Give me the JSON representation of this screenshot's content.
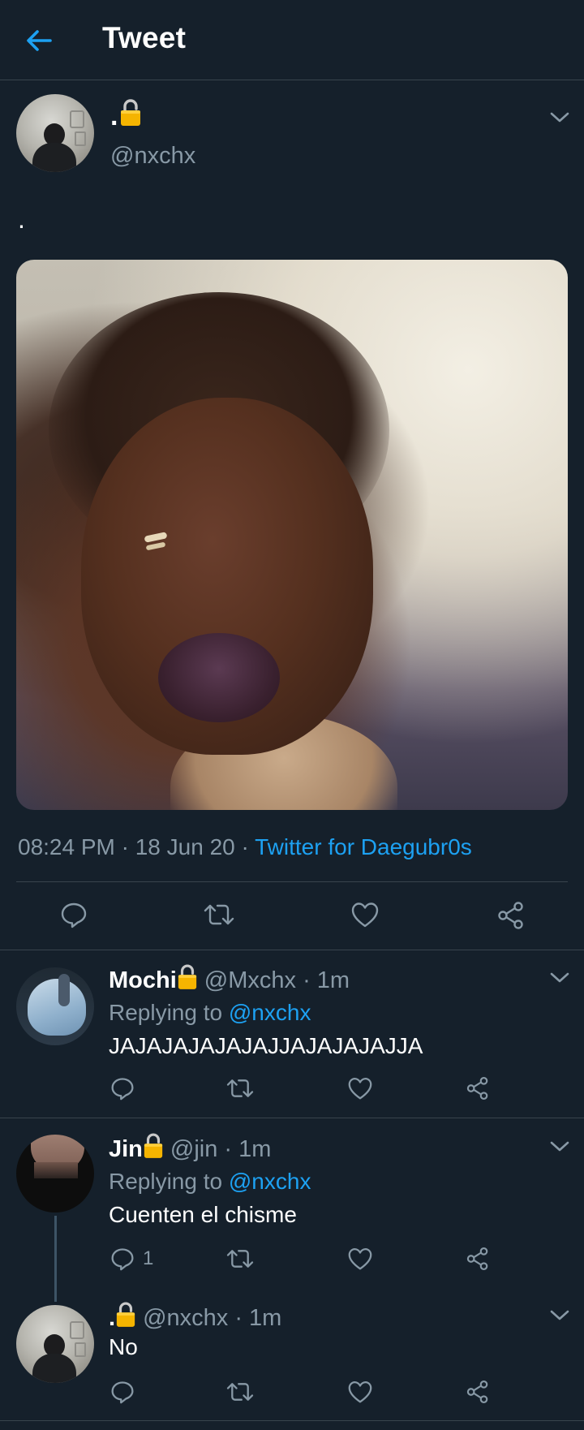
{
  "header": {
    "title": "Tweet"
  },
  "tweet": {
    "display_name": ".",
    "handle": "@nxchx",
    "text": ".",
    "timestamp": "08:24 PM · 18 Jun 20 · ",
    "source": "Twitter for Daegubr0s"
  },
  "replies": [
    {
      "display_name": "Mochi",
      "handle": "@Mxchx · 1m",
      "replying_prefix": "Replying to ",
      "replying_to": "@nxchx",
      "text": "JAJAJAJAJAJAJJAJAJAJAJJA",
      "reply_count": ""
    },
    {
      "display_name": "Jin",
      "handle": "@jin · 1m",
      "replying_prefix": "Replying to ",
      "replying_to": "@nxchx",
      "text": "Cuenten el chisme",
      "reply_count": "1"
    },
    {
      "display_name": ".",
      "handle": "@nxchx · 1m",
      "text": "No",
      "reply_count": ""
    }
  ],
  "colors": {
    "background": "#15202b",
    "accent": "#1da1f2",
    "muted": "#8899a6",
    "divider": "#38444d"
  },
  "icons": {
    "back": "arrow-left-icon",
    "more": "chevron-down-icon",
    "reply": "comment-icon",
    "retweet": "retweet-icon",
    "like": "heart-icon",
    "share": "share-icon",
    "lock": "padlock-icon"
  }
}
